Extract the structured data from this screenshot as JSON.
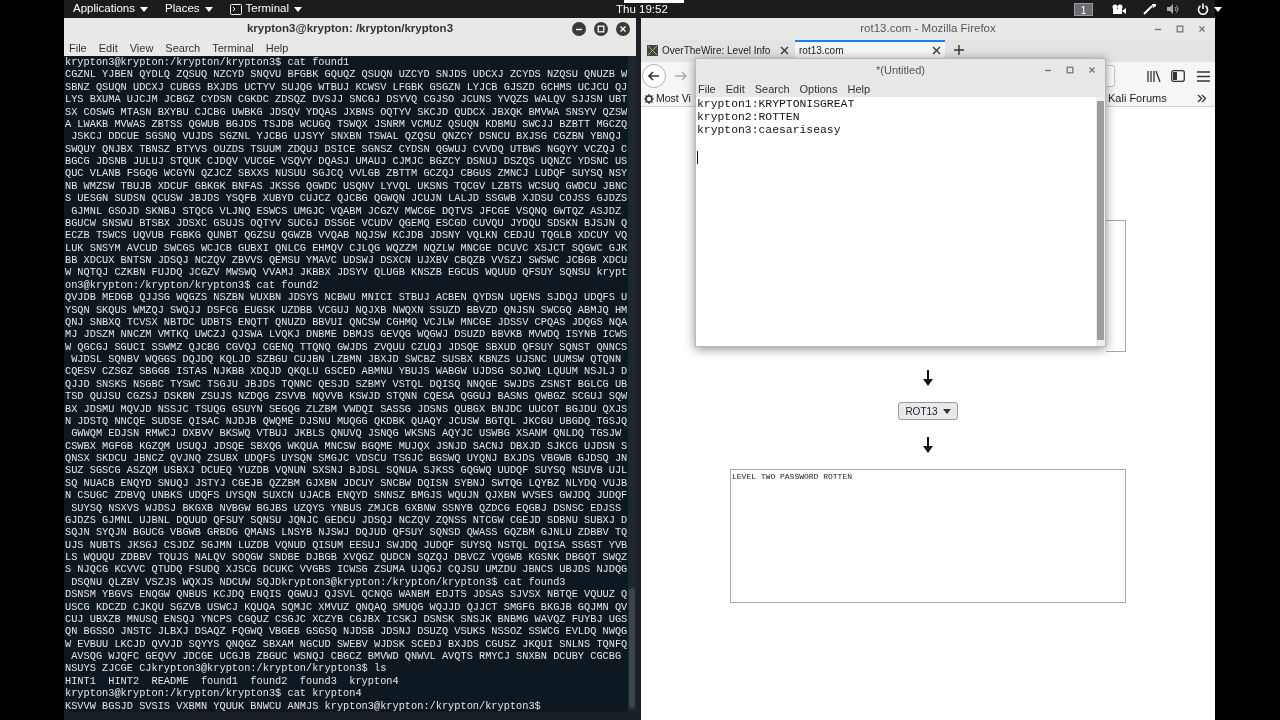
{
  "top_bar": {
    "menus": [
      {
        "label": "Applications",
        "kind": "menu"
      },
      {
        "label": "Places",
        "kind": "menu"
      },
      {
        "label": "Terminal",
        "kind": "app"
      }
    ],
    "clock": "Thu 19:52",
    "workspace": "1"
  },
  "terminal": {
    "title": "krypton3@krypton: /krypton/krypton3",
    "menu": [
      "File",
      "Edit",
      "View",
      "Search",
      "Terminal",
      "Help"
    ],
    "lines": [
      "krypton3@krypton:/krypton/krypton3$ cat found1",
      "CGZNL YJBEN QYDLQ ZQSUQ NZCYD SNQVU BFGBK GQUQZ QSUQN UZCYD SNJDS UDCXJ ZCYDS NZQSU QNUZB W",
      "SBNZ QSUQN UDCXJ CUBGS BXJDS UCTYV SUJQG WTBUJ KCWSV LFGBK GSGZN LYJCB GJSZD GCHMS UCJCU QJ",
      "LYS BXUMA UJCJM JCBGZ CYDSN CGKDC ZDSQZ DVSJJ SNCGJ DSYVQ CGJSO JCUNS YVQZS WALQV SJJSN UBT",
      "SX COSWG MTASN BXYBU CJCBG UWBKG JDSQV YDQAS JXBNS OQTYV SKCJD QUDCX JBXQK BMVWA SNSYV QZSW",
      "A LWAKB MVWAS ZBTSS QGWUB BGJDS TSJDB WCUGQ TSWQX JSNRM VCMUZ QSUQN KDBMU SWCJJ BZBTT MGCZQ",
      " JSKCJ DDCUE SGSNQ VUJDS SGZNL YJCBG UJSYY SNXBN TSWAL QZQSU QNZCY DSNCU BXJSG CGZBN YBNQJ",
      "SWQUY QNJBX TBNSZ BTYVS OUZDS TSUUM ZDQUJ DSICE SGNSZ CYDSN QGWUJ CVVDQ UTBWS NGQYY VCZQJ C",
      "BGCG JDSNB JULUJ STQUK CJDQV VUCGE VSQVY DQASJ UMAUJ CJMJC BGZCY DSNUJ DSZQS UQNZC YDSNC US",
      "QUC VLANB FSGQG WCGYN QZJCZ SBXXS NUSUU SGJCQ VVLGB ZBTTM GCZQJ CBGUS ZMNCJ LUDQF SUYSQ NSY",
      "NB WMZSW TBUJB XDCUF GBKGK BNFAS JKSSG QGWDC USQNV LYVQL UKSNS TQCGV LZBTS WCSUQ GWDCU JBNC",
      "S UESGN SUDSN QCUSW JBJDS YSQFB XUBYD CUJCZ QJCBG QGWQN JCUJN LALJD SSGWB XJDSU COJSS GJDZS",
      " GJMNL GSOJD SKNBJ STQCG VLJNQ ESWCS UMGJC VQABM JCGZV MWCGE DQTVS JFCGE VSQNQ GWTQZ ASJDZ",
      "BGUCW SNSWU BTSBX JDSXC GSUJS OQTYV SUCGJ DSSGE VCUDV QGEMQ ESCGD CUVQU JYDQU SDSKN BJSJN Q",
      "ECZB TSWCS UQVUB FGBKG QUNBT QGZSU QGWZB VVQAB NQJSW KCJDB JDSNY VQLKN CEDJU TQGLB XDCUY VQ",
      "LUK SNSYM AVCUD SWCGS WCJCB GUBXI QNLCG EHMQV CJLQG WQZZM NQZLW MNCGE DCUVC XSJCT SQGWC GJK",
      "BB XDCUX BNTSN JDSQJ NCZQV ZBVVS QEMSU YMAVC UDSWJ DSXCN UJXBV CBQZB VVSZJ SWSWC JCBGB XDCU",
      "W NQTQJ CZKBN FUJDQ JCGZV MWSWQ VVAMJ JKBBX JDSYV QLUGB KNSZB EGCUS WQUUD QFSUY SQNSU krypt",
      "on3@krypton:/krypton/krypton3$ cat found2",
      "QVJDB MEDGB QJJSG WQGZS NSZBN WUXBN JDSYS NCBWU MNICI STBUJ ACBEN QYDSN UQENS SJDQJ UDQFS U",
      "YSQN SKQUS WMZQJ SWQJJ DSFCG EUGSK UZDBB VCGUJ NQJXB NWQXN SSUZD BBVZD QNJSN SWCGQ ABMJQ HM",
      "QNJ SNBXQ TCVSX NBTDC UDBTS ENQTT QNUZD BBVUI QNCSW CGHMQ VCJLW MNCGE JDSSV CPQAS JDQGS NQA",
      "MJ JDSZM NNCZM VMTKQ UWCZJ QJSWA LVQKJ DNBME DBMJS GEVQG WQGWJ DSUZD BBVKB MVWDQ ISYNB ICWS",
      "W QGCGJ SGUCI SSWMZ QJCBG CGVQJ CGENQ TTQNQ GWJDS ZVQUU CZUQJ JDSQE SBXUD QFSUY SQNST QNNCS",
      " WJDSL SQNBV WQGGS DQJDQ KQLJD SZBGU CUJBN LZBMN JBXJD SWCBZ SUSBX KBNZS UJSNC UUMSW QTQNN",
      "CQESV CZSGZ SBGGB ISTAS NJKBB XDQJD QKQLU GSCED ABMNU YBUJS WABGW UJDSG SOJWQ LQUUM NSJLJ D",
      "QJJD SNSKS NSGBC TYSWC TSGJU JBJDS TQNNC QESJD SZBMY VSTQL DQISQ NNQGE SWJDS ZSNST BGLCG UB",
      "TSD QUJSU CGZSJ DSKBN ZSUJS NZDQG ZSVVB NQVVB KSWJD STQNN CQESA QGGUJ BASNS QWBGZ SCGUJ SQW",
      "BX JDSMU MQVJD NSSJC TSUQG GSUYN SEGQG ZLZBM VWDQI SASSG JDSNS QUBGX BNJDC UUCOT BGJDU QXJS",
      "N JDSTQ NNCQE SUDSE QISAC NJDJB QWQME DJSNU MUQGG QKDBK QUAQY JCUSW BGTQL JKCGU UBGDQ TGSJQ",
      " GWWQM EDJSN RMWCJ DXBVV BKSWQ VTBUJ JKBLS QNUVQ JSNQG WKSNS AQYJC USWBG XSANM QNLDQ TGSJW",
      "CSWBX MGFGB KGZQM USUQJ JDSQE SBXQG WKQUA MNCSW BGQME MUJQX JSNJD SACNJ DBXJD SJKCG UJDSN S",
      "QNSX SKDCU JBNCZ QVJNQ ZSUBX UDQFS UYSQN SMGJC VDSCU TSGJC BGSWQ UYQNJ BXJDS VBGWB GJDSQ JN",
      "SUZ SGSCG ASZQM USBXJ DCUEQ YUZDB VQNUN SXSNJ BJDSL SQNUA SJKSS GQGWQ UUDQF SUYSQ NSUVB UJL",
      "SQ NUACB ENQYD SNUQJ JSTYJ CGEJB QZZBM GJXBN JDCUY SNCBW DQISN SYBNJ SWTQG LQYBZ NLYDQ VUJB",
      "N CSUGC ZDBVQ UNBKS UDQFS UYSQN SUXCN UJACB ENQYD SNNSZ BMGJS WQUJN QJXBN WVSES GWJDQ JUDQF",
      " SUYSQ NSXVS WJDSJ BKGXB NVBGW BGJBS UZQYS YNBUS ZMJCB GXBNW SSNYB QZDCG EQGBJ DSNSC EDJSS",
      "GJDZS GJMNL UJBNL DQUUD QFSUY SQNSU JQNJC GEDCU JDSQJ NCZQV ZQNSS NTCGW CGEJD SDBNU SUBXJ D",
      "SQJN SYQJN BGUCG VBGWB GRBDG QMANS LNSYB NJSWJ DQJUD QFSUY SQNSD QWASS GQZBM GJNLU ZDBBV TQ",
      "UJS NUBTS JKSGJ CSJDZ SGJMN LUZDB VQNUD QISUM EESUJ SWJDQ JUDQF SUYSQ NSTQL DQISA SSGST YVB",
      "LS WQUQU ZDBBV TQUJS NALQV SOQGW SNDBE DJBGB XVQGZ QUDCN SQZQJ DBVCZ VQGWB KGSNK DBGQT SWQZ",
      "S NJQCG KCVVC QTUDQ FSUDQ XJSCG DCUKC VVGBS ICWSG ZSUMA UJQGJ CQJSU UMZDU JBNCS UBJDS NJDQG",
      " DSQNU QLZBV VSZJS WQXJS NDCUW SQJDkrypton3@krypton:/krypton/krypton3$ cat found3",
      "DSNSM YBGVS ENQGW QNBUS KCJDQ ENQIS QGWUJ QJSVL QCNQG WANBM EDJTS JDSAS SJVSX NBTQE VQUUZ Q",
      "USCG KDCZD CJKQU SGZVB USWCJ KQUQA SQMJC XMVUZ QNQAQ SMUQG WQJJD QJJCT SMGFG BKGJB GQJMN QV",
      "CUJ UBXZB MNUSQ ENSQJ YNCPS CGQUZ CSGJC XCZYB CGJBX ICSKJ DSNSK SNSJK BNBMG WAVQZ FUYBJ UGS",
      "QN BGSSO JNSTC JLBXJ DSAQZ FQGWQ VBGEB GSGSQ NJDSB JDSNJ DSUZQ VSUKS NSSOZ SSWCG EVLDQ NWQG",
      "W EVBUU LKCJD QVVJD SQYYS QNQGZ SBXAM NGCUD SWEBV WJDSK SCEDJ BXJDS CGUSZ JKQUI SNLNS TQNFQ",
      " AVSQG WJQFC GEQVV JDCGE UCGJB ZBGUC WSNQJ CBGCZ BMVWD QNWVL AVQTS RMYCJ SNXBN DCUBY CGCBG",
      "NSUYS ZJCGE CJkrypton3@krypton:/krypton/krypton3$ ls",
      "HINT1  HINT2  README  found1  found2  found3  krypton4",
      "krypton3@krypton:/krypton/krypton3$ cat krypton4",
      "KSVVW BGSJD SVSIS VXBMN YQUUK BNWCU ANMJS krypton3@krypton:/krypton/krypton3$"
    ]
  },
  "browser": {
    "title": "rot13.com - Mozilla Firefox",
    "tabs": [
      {
        "label": "OverTheWire: Level Info",
        "selected": false
      },
      {
        "label": "rot13.com",
        "selected": true
      }
    ],
    "bookmarks": [
      "Most Vi",
      "Kali Forums"
    ],
    "cipher": "ROT13",
    "output": "LEVEL TWO PASSWORD ROTTEN"
  },
  "editor": {
    "title": "*(Untitled)",
    "menu": [
      "File",
      "Edit",
      "Search",
      "Options",
      "Help"
    ],
    "lines": [
      "krypton1:KRYPTONISGREAT",
      "krypton2:ROTTEN",
      "krypton3:caesariseasy"
    ]
  }
}
